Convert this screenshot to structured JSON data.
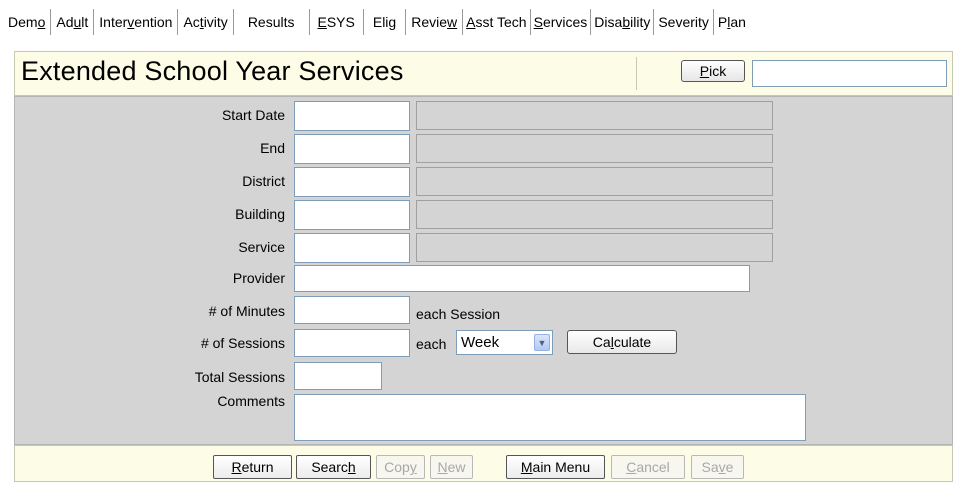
{
  "tabs": [
    {
      "pre": "Dem",
      "u": "o",
      "post": ""
    },
    {
      "pre": "Ad",
      "u": "u",
      "post": "lt"
    },
    {
      "pre": "Inter",
      "u": "v",
      "post": "ention"
    },
    {
      "pre": "Ac",
      "u": "t",
      "post": "ivity"
    },
    {
      "pre": "Results",
      "u": "",
      "post": ""
    },
    {
      "pre": "",
      "u": "E",
      "post": "SYS"
    },
    {
      "pre": "Eli",
      "u": "g",
      "post": ""
    },
    {
      "pre": "Revie",
      "u": "w",
      "post": ""
    },
    {
      "pre": "",
      "u": "A",
      "post": "sst Tech"
    },
    {
      "pre": "",
      "u": "S",
      "post": "ervices"
    },
    {
      "pre": "Disa",
      "u": "b",
      "post": "ility"
    },
    {
      "pre": "Severity",
      "u": "",
      "post": ""
    },
    {
      "pre": "P",
      "u": "l",
      "post": "an"
    }
  ],
  "header": {
    "title": "Extended School Year Services",
    "pick_label_u": "P",
    "pick_label_rest": "ick",
    "pick_value": ""
  },
  "form": {
    "start_date_label": "Start Date",
    "end_label": "End",
    "district_label": "District",
    "building_label": "Building",
    "service_label": "Service",
    "provider_label": "Provider",
    "minutes_label": "# of Minutes",
    "minutes_suffix": "each Session",
    "sessions_label": "# of Sessions",
    "sessions_each": "each",
    "sessions_unit_selected": "Week",
    "calculate_pre": "Ca",
    "calculate_u": "l",
    "calculate_post": "culate",
    "total_label": "Total Sessions",
    "comments_label": "Comments"
  },
  "bottom": {
    "return": {
      "u": "R",
      "post": "eturn"
    },
    "search": {
      "pre": "Searc",
      "u": "h"
    },
    "copy": {
      "pre": "Cop",
      "u": "y"
    },
    "new": {
      "u": "N",
      "post": "ew"
    },
    "main_menu": {
      "u": "M",
      "post": "ain Menu"
    },
    "cancel": {
      "u": "C",
      "post": "ancel"
    },
    "save": {
      "pre": "Sa",
      "u": "v",
      "post": "e"
    }
  }
}
